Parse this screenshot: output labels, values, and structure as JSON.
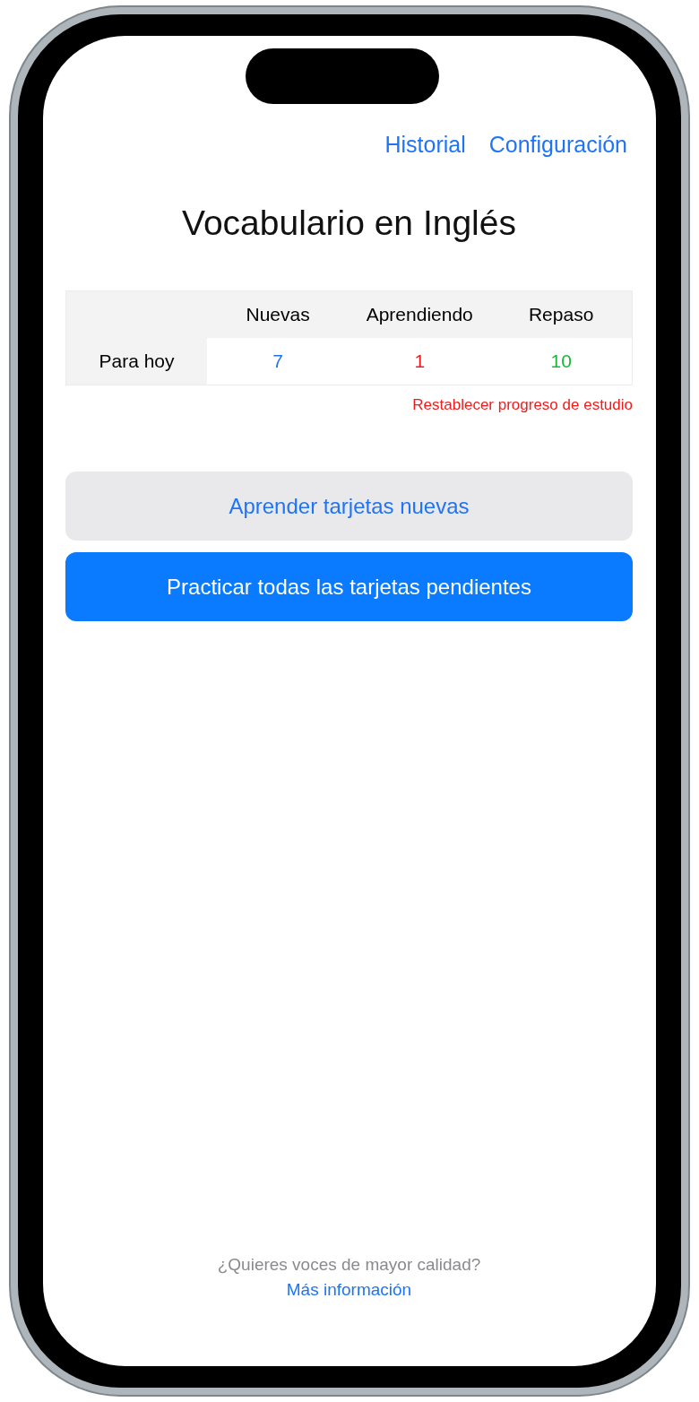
{
  "nav_links": [
    {
      "label": "Historial"
    },
    {
      "label": "Configuración"
    }
  ],
  "title": "Vocabulario en Inglés",
  "table": {
    "columns": [
      "Nuevas",
      "Aprendiendo",
      "Repaso"
    ],
    "rows": [
      {
        "label": "Para hoy",
        "cells": [
          {
            "value": "7",
            "color": "#1f74f5"
          },
          {
            "value": "1",
            "color": "#f21b1b"
          },
          {
            "value": "10",
            "color": "#1bb83a"
          }
        ]
      }
    ]
  },
  "reset_link": "Restablecer progreso de estudio",
  "buttons": [
    {
      "label": "Aprender tarjetas nuevas",
      "kind": "secondary"
    },
    {
      "label": "Practicar todas las tarjetas pendientes",
      "kind": "primary"
    }
  ],
  "footer": {
    "text": "¿Quieres voces de mayor calidad?",
    "link": "Más información"
  }
}
